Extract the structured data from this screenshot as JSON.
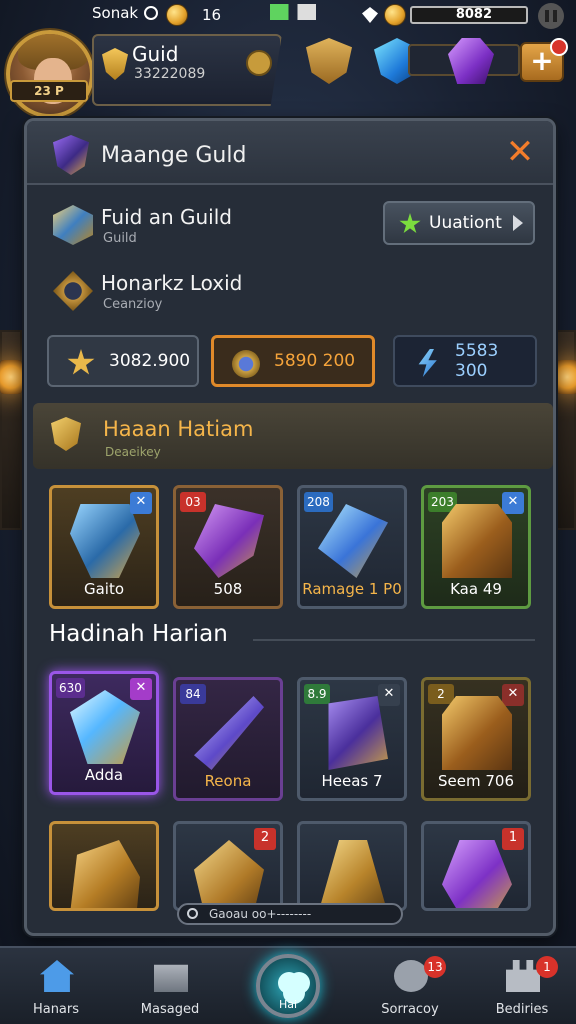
{
  "status_bar": {
    "left_text": "Sonak",
    "coins_count": "16",
    "currency_value": "8082"
  },
  "hud": {
    "avatar_tag": "23 P",
    "guild_title": "Guid",
    "guild_sub": "33222089"
  },
  "panel": {
    "title": "Maange Guld",
    "close_label": "✕",
    "row1": {
      "title": "Fuid an Guild",
      "subtitle": "Guild",
      "button_label": "Uuationt"
    },
    "row2": {
      "title": "Honarkz Loxid",
      "subtitle": "Ceanzioy"
    },
    "resources": [
      {
        "label": "3082.900",
        "icon": "star-icon"
      },
      {
        "label": "5890 200",
        "icon": "orb-icon"
      },
      {
        "label": "5583 300",
        "icon": "bolt-icon"
      }
    ],
    "featured": {
      "title": "Haaan Hatiam",
      "subtitle": "Deaeikey"
    },
    "featured_items": [
      {
        "label": "Gaito",
        "tag": "",
        "corner": "✕",
        "icon": "mask-icon"
      },
      {
        "label": "508",
        "tag": "03",
        "corner": "",
        "icon": "gauntlet-icon"
      },
      {
        "label": "Ramage 1 P0",
        "tag": "208",
        "corner": "",
        "icon": "drill-icon"
      },
      {
        "label": "Kaa 49",
        "tag": "203",
        "corner": "✕",
        "icon": "chest-icon"
      }
    ],
    "section_title": "Hadinah Harian",
    "section_items": [
      {
        "label": "Adda",
        "tag": "630",
        "corner": "✕",
        "icon": "crystal-icon"
      },
      {
        "label": "Reona",
        "tag": "84",
        "corner": "",
        "icon": "blade-icon"
      },
      {
        "label": "Heeas 7",
        "tag": "8.9",
        "corner": "✕",
        "icon": "box-icon"
      },
      {
        "label": "Seem 706",
        "tag": "2",
        "corner": "✕",
        "icon": "chest-icon"
      }
    ],
    "third_row_items": [
      {
        "label": "",
        "tag": "",
        "corner": "",
        "icon": "boot-icon"
      },
      {
        "label": "",
        "tag": "",
        "corner": "2",
        "icon": "helm-icon"
      },
      {
        "label": "",
        "tag": "",
        "corner": "",
        "icon": "bell-icon"
      },
      {
        "label": "",
        "tag": "",
        "corner": "1",
        "icon": "purse-icon"
      }
    ],
    "search_text": "Gaoau oo+--------"
  },
  "nav": {
    "items": [
      {
        "label": "Hanars",
        "badge": "",
        "icon": "home-icon"
      },
      {
        "label": "Masaged",
        "badge": "",
        "icon": "mail-icon"
      },
      {
        "label": "Sorracoy",
        "badge": "13",
        "icon": "chat-icon"
      },
      {
        "label": "Bediries",
        "badge": "1",
        "icon": "castle-icon"
      }
    ],
    "center_label": "Hai"
  },
  "colors": {
    "accent_orange": "#e08a2a",
    "panel_bg": "#262d38",
    "gold_text": "#f5b54a"
  }
}
